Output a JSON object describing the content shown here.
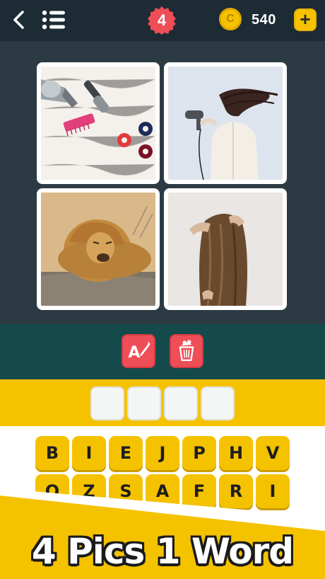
{
  "header": {
    "level": "4",
    "coins": "540",
    "coin_symbol": "C",
    "add_label": "+",
    "back_icon": "chevron-left-icon",
    "menu_icon": "list-icon"
  },
  "images": [
    {
      "name": "hair-tools-image"
    },
    {
      "name": "hair-dryer-woman-image"
    },
    {
      "name": "lion-mane-image"
    },
    {
      "name": "long-hair-woman-image"
    }
  ],
  "tools": [
    {
      "name": "reveal-letter-button",
      "icon": "letter-wand-icon"
    },
    {
      "name": "remove-letters-button",
      "icon": "trash-icon"
    }
  ],
  "answer": {
    "slots": [
      "",
      "",
      "",
      ""
    ]
  },
  "keyboard": {
    "row1": [
      "B",
      "I",
      "E",
      "J",
      "P",
      "H",
      "V"
    ],
    "row2": [
      "Q",
      "Z",
      "S",
      "A",
      "F",
      "R",
      "I"
    ]
  },
  "brand": "4 Pics 1 Word",
  "colors": {
    "accent_yellow": "#f5c200",
    "tool_red": "#ee4e57",
    "teal": "#154a4b",
    "dark": "#1c2b34"
  }
}
